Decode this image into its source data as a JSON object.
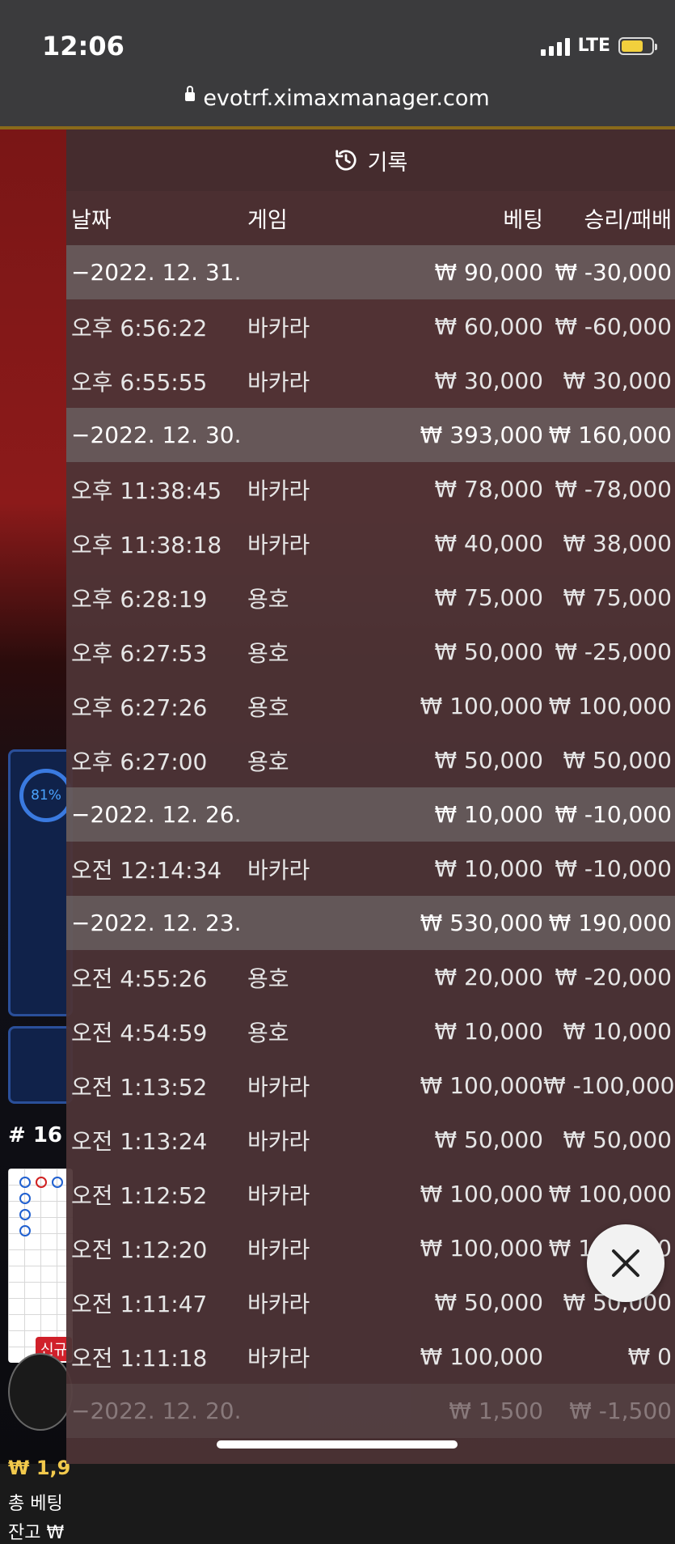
{
  "status_bar": {
    "time": "12:06",
    "network": "LTE"
  },
  "browser": {
    "url": "evotrf.ximaxmanager.com"
  },
  "background": {
    "progress_label": "81%",
    "table_number": "# 16",
    "new_badge": "신규",
    "balance": "₩ 1,9",
    "total_bet": "총 베팅",
    "remaining": "잔고 ₩"
  },
  "history": {
    "title": "기록",
    "columns": {
      "date": "날짜",
      "game": "게임",
      "bet": "베팅",
      "result": "승리/패배"
    },
    "rows": [
      {
        "type": "group",
        "date": "−2022. 12. 31.",
        "bet": "₩ 90,000",
        "result": "₩ -30,000"
      },
      {
        "type": "item",
        "date": "오후 6:56:22",
        "game": "바카라",
        "bet": "₩ 60,000",
        "result": "₩ -60,000"
      },
      {
        "type": "item",
        "date": "오후 6:55:55",
        "game": "바카라",
        "bet": "₩ 30,000",
        "result": "₩ 30,000"
      },
      {
        "type": "group",
        "date": "−2022. 12. 30.",
        "bet": "₩ 393,000",
        "result": "₩ 160,000"
      },
      {
        "type": "item",
        "date": "오후 11:38:45",
        "game": "바카라",
        "bet": "₩ 78,000",
        "result": "₩ -78,000"
      },
      {
        "type": "item",
        "date": "오후 11:38:18",
        "game": "바카라",
        "bet": "₩ 40,000",
        "result": "₩ 38,000"
      },
      {
        "type": "item",
        "date": "오후 6:28:19",
        "game": "용호",
        "bet": "₩ 75,000",
        "result": "₩ 75,000"
      },
      {
        "type": "item",
        "date": "오후 6:27:53",
        "game": "용호",
        "bet": "₩ 50,000",
        "result": "₩ -25,000"
      },
      {
        "type": "item",
        "date": "오후 6:27:26",
        "game": "용호",
        "bet": "₩ 100,000",
        "result": "₩ 100,000"
      },
      {
        "type": "item",
        "date": "오후 6:27:00",
        "game": "용호",
        "bet": "₩ 50,000",
        "result": "₩ 50,000"
      },
      {
        "type": "group",
        "date": "−2022. 12. 26.",
        "bet": "₩ 10,000",
        "result": "₩ -10,000"
      },
      {
        "type": "item",
        "date": "오전 12:14:34",
        "game": "바카라",
        "bet": "₩ 10,000",
        "result": "₩ -10,000"
      },
      {
        "type": "group",
        "date": "−2022. 12. 23.",
        "bet": "₩ 530,000",
        "result": "₩ 190,000"
      },
      {
        "type": "item",
        "date": "오전 4:55:26",
        "game": "용호",
        "bet": "₩ 20,000",
        "result": "₩ -20,000"
      },
      {
        "type": "item",
        "date": "오전 4:54:59",
        "game": "용호",
        "bet": "₩ 10,000",
        "result": "₩ 10,000"
      },
      {
        "type": "item",
        "date": "오전 1:13:52",
        "game": "바카라",
        "bet": "₩ 100,000",
        "result": "₩ -100,000"
      },
      {
        "type": "item",
        "date": "오전 1:13:24",
        "game": "바카라",
        "bet": "₩ 50,000",
        "result": "₩ 50,000"
      },
      {
        "type": "item",
        "date": "오전 1:12:52",
        "game": "바카라",
        "bet": "₩ 100,000",
        "result": "₩ 100,000"
      },
      {
        "type": "item",
        "date": "오전 1:12:20",
        "game": "바카라",
        "bet": "₩ 100,000",
        "result": "₩ 100,000"
      },
      {
        "type": "item",
        "date": "오전 1:11:47",
        "game": "바카라",
        "bet": "₩ 50,000",
        "result": "₩ 50,000"
      },
      {
        "type": "item",
        "date": "오전 1:11:18",
        "game": "바카라",
        "bet": "₩ 100,000",
        "result": "₩ 0"
      },
      {
        "type": "group",
        "date": "−2022. 12. 20.",
        "bet": "₩ 1,500",
        "result": "₩ -1,500"
      }
    ]
  },
  "icons": {
    "history": "history-icon",
    "close": "close-icon",
    "lock": "lock-icon"
  }
}
